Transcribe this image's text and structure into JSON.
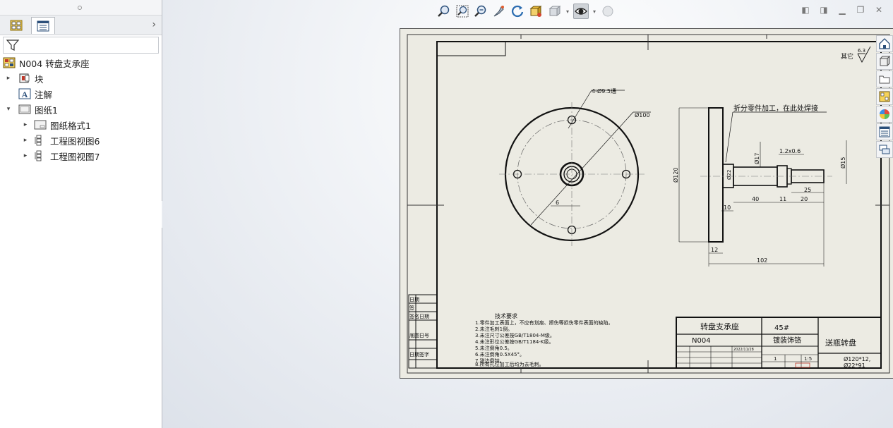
{
  "tree": {
    "root": "N004 转盘支承座",
    "items": [
      {
        "label": "块",
        "indent": 1,
        "toggle": "▸"
      },
      {
        "label": "注解",
        "indent": 1,
        "toggle": ""
      },
      {
        "label": "图纸1",
        "indent": 1,
        "toggle": "▾"
      },
      {
        "label": "图纸格式1",
        "indent": 2,
        "toggle": "▸"
      },
      {
        "label": "工程图视图6",
        "indent": 2,
        "toggle": "▸"
      },
      {
        "label": "工程图视图7",
        "indent": 2,
        "toggle": "▸"
      }
    ]
  },
  "icons": {
    "hud": [
      "zoom-to-fit-icon",
      "zoom-to-area-icon",
      "zoom-in-out-icon",
      "pan-icon",
      "rotate-icon",
      "3d-view-icon",
      "display-style-icon",
      "hide-show-icon",
      "appearance-icon"
    ],
    "task": [
      "home-icon",
      "design-library-icon",
      "file-explorer-icon",
      "view-palette-icon",
      "appearances-icon",
      "custom-properties-icon",
      "forum-icon"
    ]
  },
  "drawing": {
    "surface_finish": "其它",
    "surface_value": "6.3",
    "hole_note": "4-Ø9.5通",
    "dim_d100": "Ø100",
    "dim_6": "6",
    "weld_note": "折分零件加工，在此处焊接",
    "dim_d120": "Ø120",
    "dim_d17": "Ø17",
    "dim_d15": "Ø15",
    "dim_groove": "1.2x0.6",
    "dim_d22": "Ø22",
    "dim_10": "10",
    "dim_40": "40",
    "dim_11": "11",
    "dim_20": "20",
    "dim_25": "25",
    "dim_12": "12",
    "dim_102": "102",
    "tech_title": "技术要求",
    "tech_lines": [
      "1.零件加工表面上，不应有划痕、擦伤等损伤零件表面的缺陷。",
      "2.未注毛刺1倒。",
      "3.未注尺寸公差按GB/T1804-M级。",
      "4.未注形位公差按GB/T1184-K级。",
      "5.未注倒角0.5。",
      "6.未注倒角0.5X45°。",
      "7.锐边倒钝。",
      "8.所有孔位加工后均为去毛刺。"
    ],
    "left_block": [
      "日期",
      "签",
      "签名日期",
      "底图日号",
      "日期签字"
    ],
    "title_block": {
      "part_name": "转盘支承座",
      "drawing_no": "N004",
      "material": "45#",
      "weight": "镀装饰铬",
      "assembly": "送瓶转盘",
      "scale": "1:5",
      "qty": "1",
      "size_note": "Ø120*12,",
      "size_note2": "Ø22*91",
      "date": "2022/11/28"
    }
  }
}
